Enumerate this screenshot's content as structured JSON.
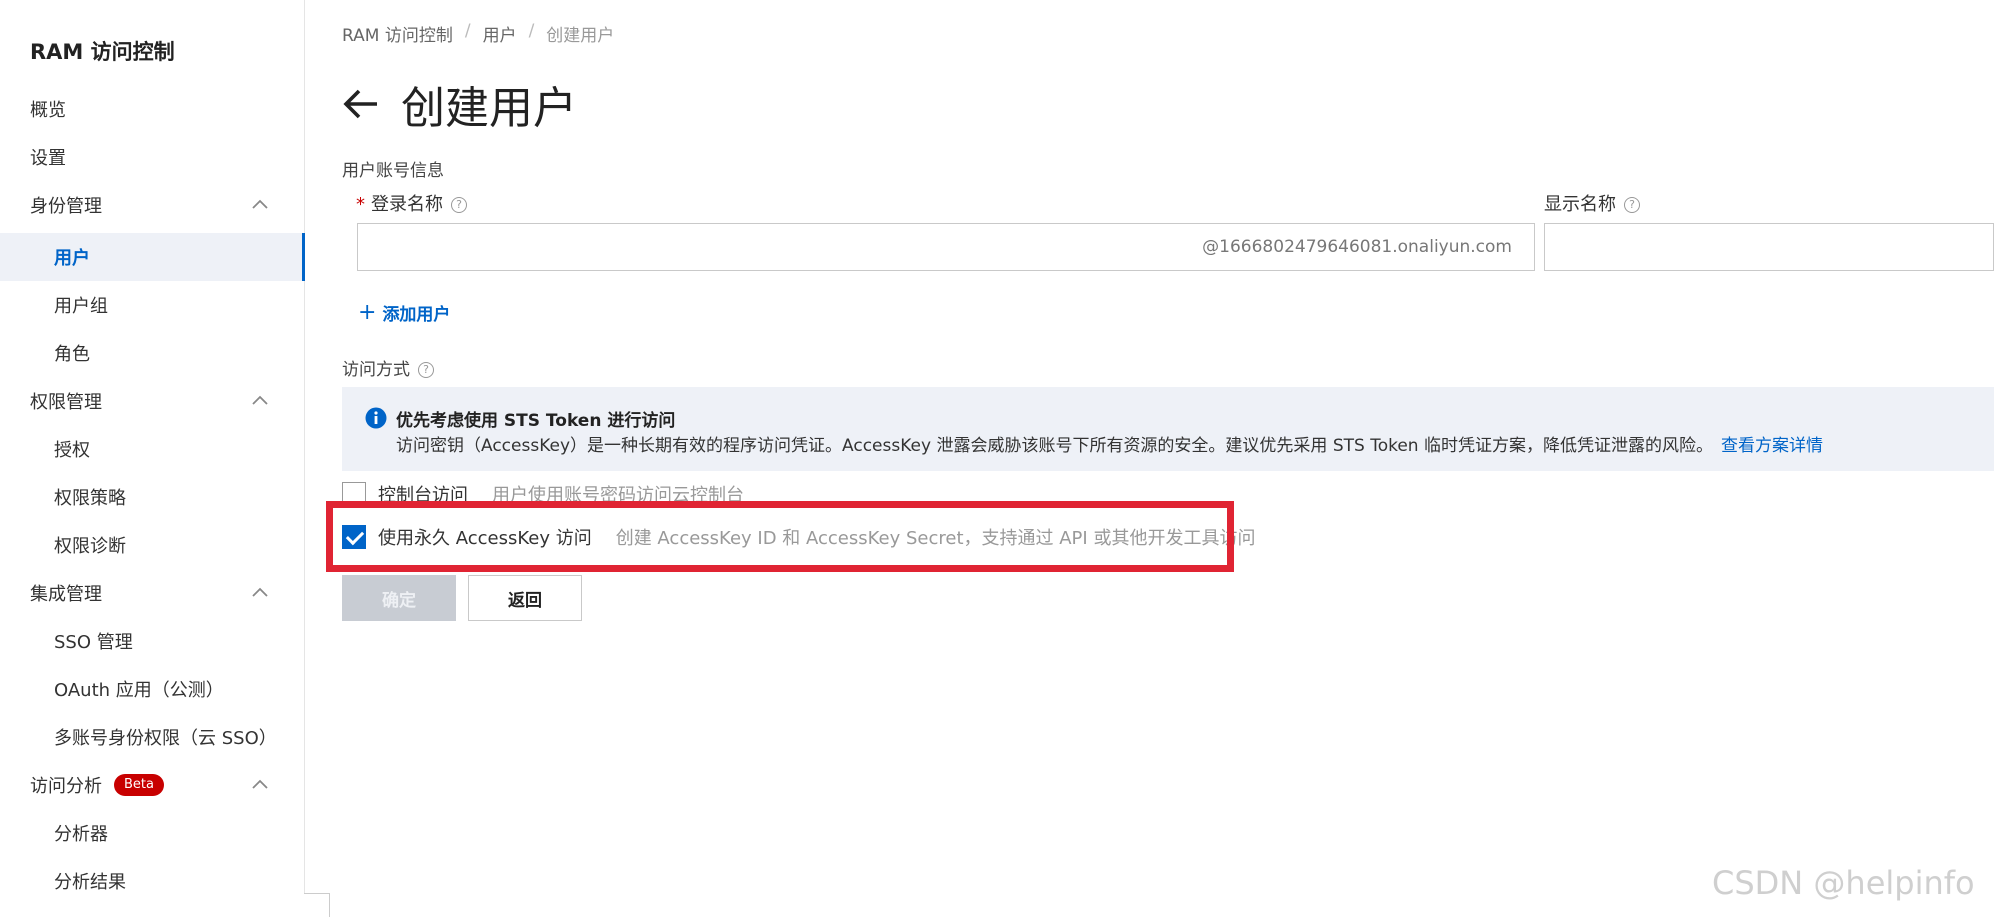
{
  "sidebar": {
    "title": "RAM 访问控制",
    "items": [
      {
        "label": "概览"
      },
      {
        "label": "设置"
      },
      {
        "label": "身份管理"
      },
      {
        "label": "用户"
      },
      {
        "label": "用户组"
      },
      {
        "label": "角色"
      },
      {
        "label": "权限管理"
      },
      {
        "label": "授权"
      },
      {
        "label": "权限策略"
      },
      {
        "label": "权限诊断"
      },
      {
        "label": "集成管理"
      },
      {
        "label": "SSO 管理"
      },
      {
        "label": "OAuth 应用（公测）"
      },
      {
        "label": "多账号身份权限（云 SSO）"
      },
      {
        "label": "访问分析",
        "badge": "Beta"
      },
      {
        "label": "分析器"
      },
      {
        "label": "分析结果"
      }
    ]
  },
  "breadcrumb": [
    "RAM 访问控制",
    "用户",
    "创建用户"
  ],
  "page_title": "创建用户",
  "form": {
    "section_account": "用户账号信息",
    "login_name_label": "登录名称",
    "login_suffix": "@1666802479646081.onaliyun.com",
    "display_name_label": "显示名称",
    "add_user": "添加用户",
    "access_label": "访问方式",
    "notice_title": "优先考虑使用 STS Token 进行访问",
    "notice_text": "访问密钥（AccessKey）是一种长期有效的程序访问凭证。AccessKey 泄露会威胁该账号下所有资源的安全。建议优先采用 STS Token 临时凭证方案，降低凭证泄露的风险。",
    "notice_link": "查看方案详情",
    "console_label": "控制台访问",
    "console_desc": "用户使用账号密码访问云控制台",
    "ak_label": "使用永久 AccessKey 访问",
    "ak_desc": "创建 AccessKey ID 和 AccessKey Secret，支持通过 API 或其他开发工具访问",
    "ak_checked": true,
    "console_checked": false,
    "confirm_button": "确定",
    "back_button": "返回"
  },
  "watermark": "CSDN @helpinfo",
  "colors": {
    "accent": "#0064c8",
    "highlight": "#e02433",
    "badge": "#c80000"
  }
}
